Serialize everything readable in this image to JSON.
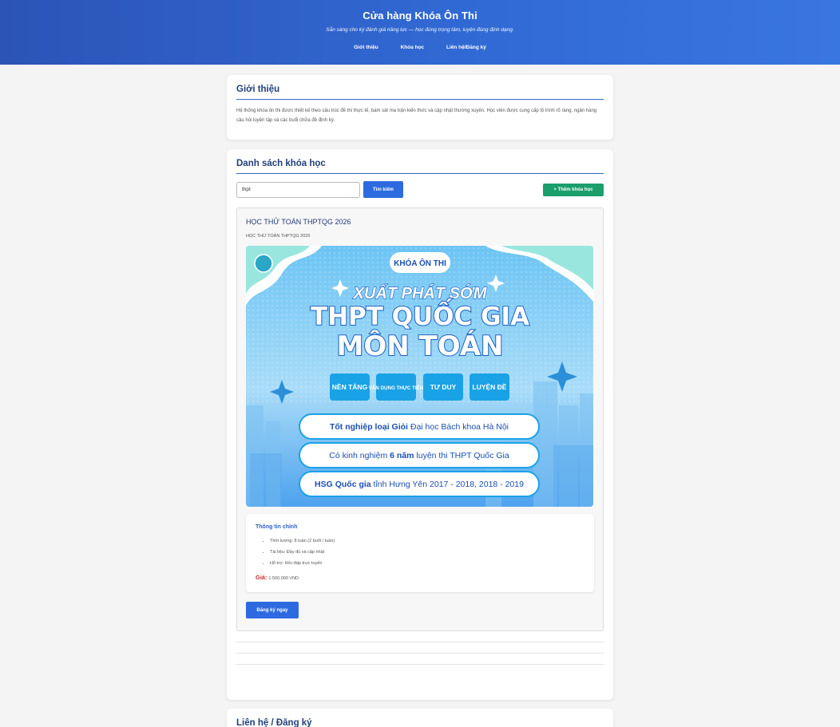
{
  "header": {
    "title": "Cửa hàng Khóa Ôn Thi",
    "tagline": "Sẵn sàng cho kỳ đánh giá năng lực — học đúng trọng tâm, luyện đúng định dạng.",
    "nav": [
      "Giới thiệu",
      "Khóa học",
      "Liên hệ/Đăng ký"
    ]
  },
  "intro": {
    "heading": "Giới thiệu",
    "text": "Hệ thống khóa ôn thi được thiết kế theo cấu trúc đề thi thực tế, bám sát ma trận kiến thức và cập nhật thường xuyên. Học viên được cung cấp lộ trình rõ ràng, ngân hàng câu hỏi luyện tập và các buổi chữa đề định kỳ."
  },
  "courses": {
    "heading": "Danh sách khóa học",
    "search_value": "thpt",
    "search_button": "Tìm kiếm",
    "add_button": "+ Thêm khóa học",
    "items": [
      {
        "title": "HỌC THỬ TOÁN THPTQG 2026",
        "subtitle": "HỌC THỬ TOÁN THPTQG 2026",
        "banner": {
          "badge": "KHÓA ÔN THI",
          "line1": "XUẤT PHÁT SỚM",
          "line2": "THPT QUỐC GIA",
          "line3": "MÔN TOÁN",
          "tags": [
            "NỀN TẢNG",
            "VẬN DỤNG THỰC TIỄN",
            "TƯ DUY",
            "LUYỆN ĐỀ"
          ],
          "pill1_bold": "Tốt nghiệp loại Giỏi",
          "pill1_rest": " Đại học Bách khoa Hà Nội",
          "pill2_a": "Có kinh nghiệm ",
          "pill2_bold": "6 năm",
          "pill2_b": " luyện thi THPT Quốc Gia",
          "pill3_bold": "HSG Quốc gia",
          "pill3_rest": " tỉnh Hưng Yên 2017 - 2018, 2018 - 2019"
        },
        "info_heading": "Thông tin chính",
        "info_items": [
          "Thời lượng: 8 tuần (2 buổi / tuần)",
          "Tài liệu: Đầy đủ và cập nhật",
          "Hỗ trợ: Hỏi–đáp trực tuyến"
        ],
        "price_label": "Giá:",
        "price_value": "1.500.000 VND",
        "register_button": "Đăng ký ngay"
      }
    ]
  },
  "contact": {
    "heading": "Liên hệ / Đăng ký"
  },
  "colors": {
    "header_gradient_start": "#2c54b6",
    "header_gradient_end": "#3a76e0",
    "heading": "#1f3f7a",
    "primary_button": "#2d6ae0",
    "add_button": "#1a9e6c",
    "price_label": "#c0322b"
  }
}
